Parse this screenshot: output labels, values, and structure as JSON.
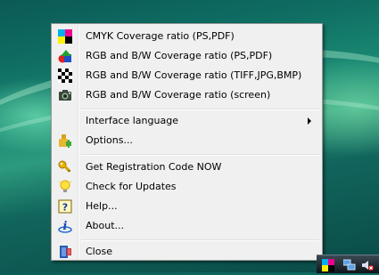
{
  "menu": {
    "items": [
      {
        "label": "CMYK Coverage ratio (PS,PDF)",
        "icon": "cmyk-squares-icon"
      },
      {
        "label": "RGB and B/W Coverage ratio (PS,PDF)",
        "icon": "rgb-shapes-icon"
      },
      {
        "label": "RGB and B/W Coverage ratio (TIFF,JPG,BMP)",
        "icon": "checkerboard-icon"
      },
      {
        "label": "RGB and B/W Coverage ratio (screen)",
        "icon": "camera-icon"
      },
      {
        "label": "Interface language",
        "icon": "",
        "submenu": true
      },
      {
        "label": "Options...",
        "icon": "options-plugin-icon"
      },
      {
        "label": "Get Registration Code NOW",
        "icon": "key-icon"
      },
      {
        "label": "Check for Updates",
        "icon": "lightbulb-icon"
      },
      {
        "label": "Help...",
        "icon": "help-question-icon"
      },
      {
        "label": "About...",
        "icon": "info-icon"
      },
      {
        "label": "Close",
        "icon": "close-door-icon"
      }
    ]
  },
  "tray": {
    "icons": [
      "app-tray-icon",
      "network-icon",
      "volume-muted-icon"
    ]
  }
}
